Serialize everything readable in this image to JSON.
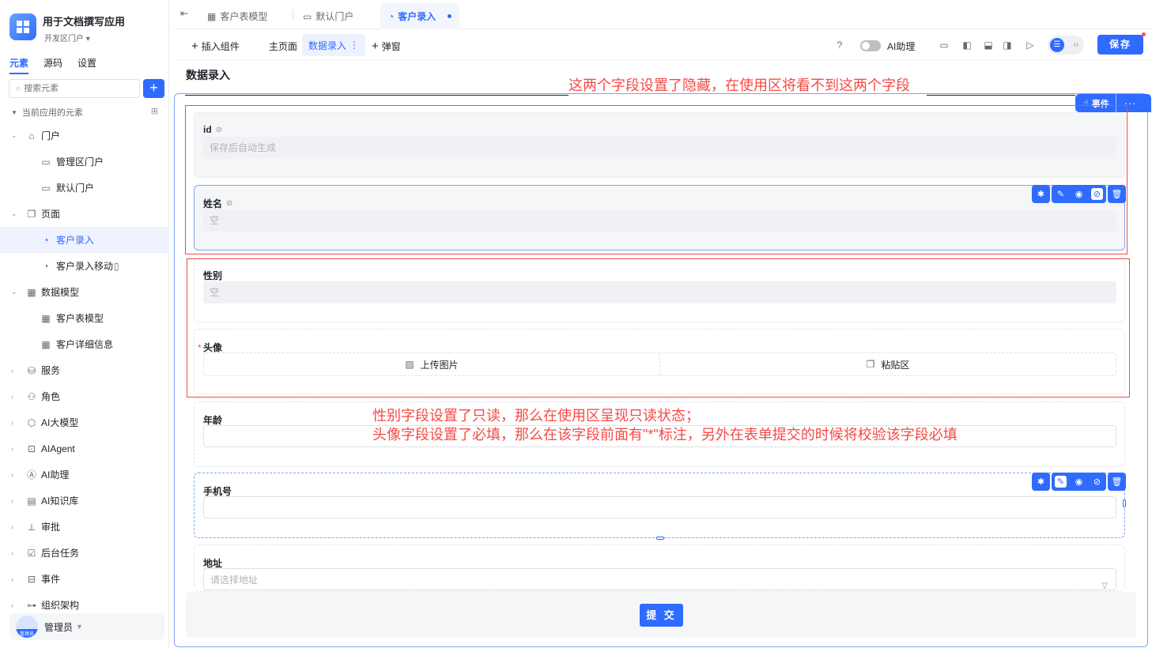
{
  "app": {
    "title": "用于文档撰写应用",
    "portal": "开发区门户"
  },
  "sidebar": {
    "tabs": [
      "元素",
      "源码",
      "设置"
    ],
    "search_placeholder": "搜索元素",
    "tree_header": "当前应用的元素",
    "items": [
      {
        "label": "门户",
        "icon": "home-icon",
        "level": 1,
        "expandable": true
      },
      {
        "label": "管理区门户",
        "icon": "portal-icon",
        "level": 2
      },
      {
        "label": "默认门户",
        "icon": "portal-icon",
        "level": 2
      },
      {
        "label": "页面",
        "icon": "pages-icon",
        "level": 1,
        "expandable": true
      },
      {
        "label": "客户录入",
        "icon": "page-icon",
        "level": 2,
        "selected": true
      },
      {
        "label": "客户录入移动",
        "icon": "page-icon",
        "level": 2,
        "suffix_icon": "mobile-icon"
      },
      {
        "label": "数据模型",
        "icon": "table-icon",
        "level": 1,
        "expandable": true
      },
      {
        "label": "客户表模型",
        "icon": "table-icon",
        "level": 2
      },
      {
        "label": "客户详细信息",
        "icon": "table-icon",
        "level": 2
      },
      {
        "label": "服务",
        "icon": "service-icon",
        "level": 1
      },
      {
        "label": "角色",
        "icon": "role-icon",
        "level": 1
      },
      {
        "label": "AI大模型",
        "icon": "model-icon",
        "level": 1
      },
      {
        "label": "AIAgent",
        "icon": "robot-icon",
        "level": 1
      },
      {
        "label": "AI助理",
        "icon": "assistant-icon",
        "level": 1
      },
      {
        "label": "AI知识库",
        "icon": "knowledge-icon",
        "level": 1
      },
      {
        "label": "审批",
        "icon": "stamp-icon",
        "level": 1
      },
      {
        "label": "后台任务",
        "icon": "task-icon",
        "level": 1
      },
      {
        "label": "事件",
        "icon": "event-icon",
        "level": 1
      },
      {
        "label": "组织架构",
        "icon": "org-icon",
        "level": 1
      }
    ],
    "user": {
      "name": "管理员",
      "avatar_text": "管理员"
    }
  },
  "tabs": [
    {
      "label": "客户表模型",
      "icon": "table-icon"
    },
    {
      "label": "默认门户",
      "icon": "portal-icon"
    },
    {
      "label": "客户录入",
      "icon": "page-icon",
      "active": true
    }
  ],
  "toolbar": {
    "insert": "插入组件",
    "main_page": "主页面",
    "data_entry": "数据录入",
    "popup": "弹窗",
    "ai_assistant": "AI助理",
    "save": "保存"
  },
  "page": {
    "title": "数据录入",
    "event_label": "事件",
    "fields": [
      {
        "label": "id",
        "value": "保存后自动生成",
        "hidden": true
      },
      {
        "label": "姓名",
        "value": "空",
        "hidden": true
      },
      {
        "label": "性别",
        "value": "空",
        "readonly": true
      },
      {
        "label": "头像",
        "required": true,
        "upload_label": "上传图片",
        "paste_label": "粘贴区"
      },
      {
        "label": "年龄",
        "value": ""
      },
      {
        "label": "手机号",
        "value": ""
      },
      {
        "label": "地址",
        "placeholder": "请选择地址"
      }
    ],
    "submit": "提 交"
  },
  "annotations": {
    "hidden_note": "这两个字段设置了隐藏，在使用区将看不到这两个字段",
    "readonly_note": "性别字段设置了只读，那么在使用区呈现只读状态；",
    "required_note": "头像字段设置了必填，那么在该字段前面有\"*\"标注，另外在表单提交的时候将校验该字段必填"
  },
  "colors": {
    "accent": "#2f6bff",
    "annotation": "#f54a45"
  }
}
